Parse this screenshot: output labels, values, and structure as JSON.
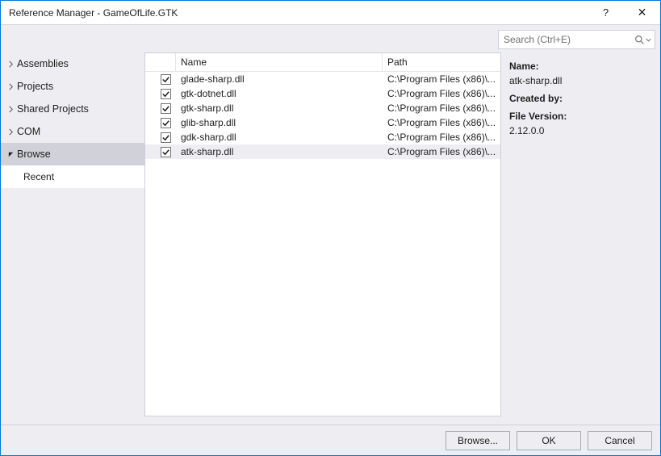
{
  "window": {
    "title": "Reference Manager - GameOfLife.GTK"
  },
  "search": {
    "placeholder": "Search (Ctrl+E)"
  },
  "nav": {
    "items": [
      {
        "label": "Assemblies",
        "expanded": false
      },
      {
        "label": "Projects",
        "expanded": false
      },
      {
        "label": "Shared Projects",
        "expanded": false
      },
      {
        "label": "COM",
        "expanded": false
      },
      {
        "label": "Browse",
        "expanded": true,
        "selected": true,
        "children": [
          {
            "label": "Recent"
          }
        ]
      }
    ]
  },
  "list": {
    "columns": {
      "name": "Name",
      "path": "Path"
    },
    "rows": [
      {
        "checked": true,
        "name": "glade-sharp.dll",
        "path": "C:\\Program Files (x86)\\..."
      },
      {
        "checked": true,
        "name": "gtk-dotnet.dll",
        "path": "C:\\Program Files (x86)\\..."
      },
      {
        "checked": true,
        "name": "gtk-sharp.dll",
        "path": "C:\\Program Files (x86)\\..."
      },
      {
        "checked": true,
        "name": "glib-sharp.dll",
        "path": "C:\\Program Files (x86)\\..."
      },
      {
        "checked": true,
        "name": "gdk-sharp.dll",
        "path": "C:\\Program Files (x86)\\..."
      },
      {
        "checked": true,
        "name": "atk-sharp.dll",
        "path": "C:\\Program Files (x86)\\...",
        "selected": true
      }
    ]
  },
  "details": {
    "name_label": "Name:",
    "name_value": "atk-sharp.dll",
    "createdby_label": "Created by:",
    "createdby_value": "",
    "fileversion_label": "File Version:",
    "fileversion_value": "2.12.0.0"
  },
  "footer": {
    "browse": "Browse...",
    "ok": "OK",
    "cancel": "Cancel"
  }
}
